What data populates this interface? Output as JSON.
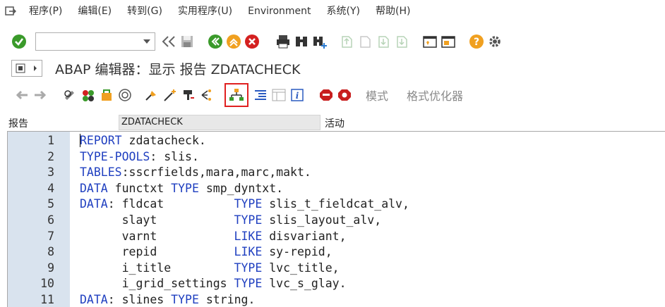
{
  "menubar": {
    "items": [
      "程序(P)",
      "编辑(E)",
      "转到(G)",
      "实用程序(U)",
      "Environment",
      "系统(Y)",
      "帮助(H)"
    ]
  },
  "title": "ABAP 编辑器：显示 报告 ZDATACHECK",
  "app_toolbar": {
    "text_buttons": [
      "模式",
      "格式优化器"
    ]
  },
  "fields": {
    "label": "报告",
    "value": "ZDATACHECK",
    "status": "活动"
  },
  "code": {
    "lines": [
      {
        "n": "1",
        "segs": [
          {
            "t": "REPORT",
            "k": 1
          },
          {
            "t": " zdatacheck.",
            "k": 0
          }
        ]
      },
      {
        "n": "2",
        "segs": [
          {
            "t": "TYPE-POOLS",
            "k": 1
          },
          {
            "t": ": slis.",
            "k": 0
          }
        ]
      },
      {
        "n": "3",
        "segs": [
          {
            "t": "TABLES",
            "k": 1
          },
          {
            "t": ":sscrfields,mara,marc,makt.",
            "k": 0
          }
        ]
      },
      {
        "n": "4",
        "segs": [
          {
            "t": "DATA",
            "k": 1
          },
          {
            "t": " functxt ",
            "k": 0
          },
          {
            "t": "TYPE",
            "k": 1
          },
          {
            "t": " smp_dyntxt.",
            "k": 0
          }
        ]
      },
      {
        "n": "5",
        "segs": [
          {
            "t": "DATA",
            "k": 1
          },
          {
            "t": ": fldcat          ",
            "k": 0
          },
          {
            "t": "TYPE",
            "k": 1
          },
          {
            "t": " slis_t_fieldcat_alv,",
            "k": 0
          }
        ]
      },
      {
        "n": "6",
        "segs": [
          {
            "t": "      slayt           ",
            "k": 0
          },
          {
            "t": "TYPE",
            "k": 1
          },
          {
            "t": " slis_layout_alv,",
            "k": 0
          }
        ]
      },
      {
        "n": "7",
        "segs": [
          {
            "t": "      varnt           ",
            "k": 0
          },
          {
            "t": "LIKE",
            "k": 1
          },
          {
            "t": " disvariant,",
            "k": 0
          }
        ]
      },
      {
        "n": "8",
        "segs": [
          {
            "t": "      repid           ",
            "k": 0
          },
          {
            "t": "LIKE",
            "k": 1
          },
          {
            "t": " sy-repid,",
            "k": 0
          }
        ]
      },
      {
        "n": "9",
        "segs": [
          {
            "t": "      i_title         ",
            "k": 0
          },
          {
            "t": "TYPE",
            "k": 1
          },
          {
            "t": " lvc_title,",
            "k": 0
          }
        ]
      },
      {
        "n": "10",
        "segs": [
          {
            "t": "      i_grid_settings ",
            "k": 0
          },
          {
            "t": "TYPE",
            "k": 1
          },
          {
            "t": " lvc_s_glay.",
            "k": 0
          }
        ]
      },
      {
        "n": "11",
        "segs": [
          {
            "t": "DATA",
            "k": 1
          },
          {
            "t": ": slines ",
            "k": 0
          },
          {
            "t": "TYPE",
            "k": 1
          },
          {
            "t": " string.",
            "k": 0
          }
        ]
      }
    ]
  }
}
